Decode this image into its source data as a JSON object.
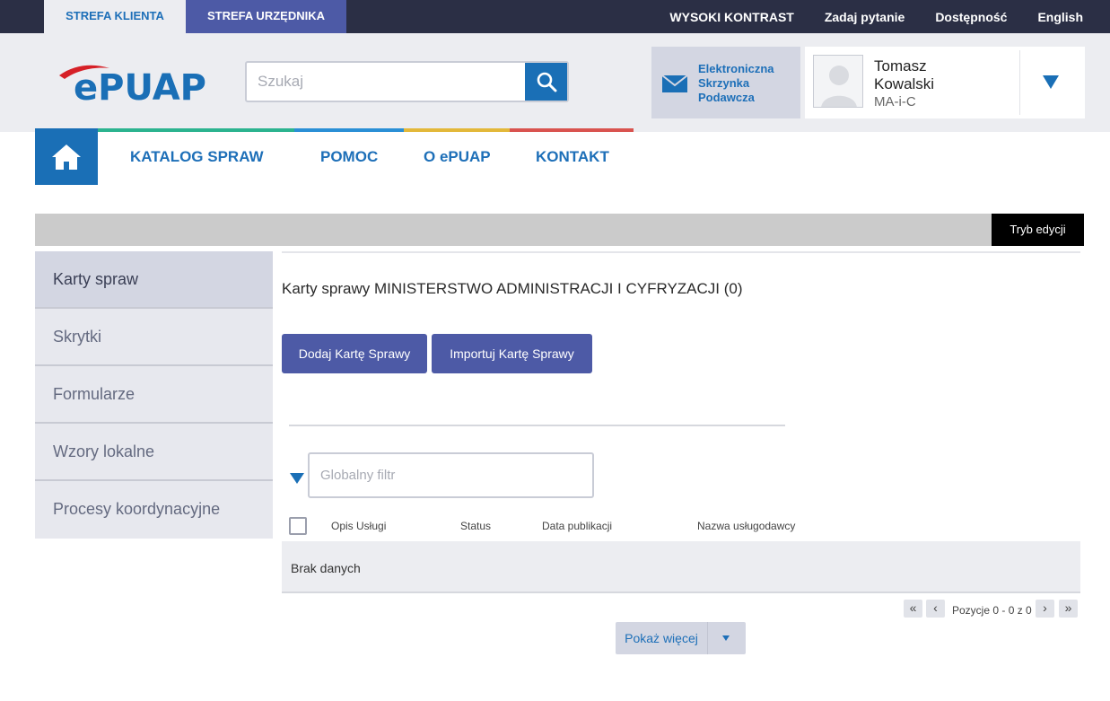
{
  "topbar": {
    "tab_client": "STREFA KLIENTA",
    "tab_official": "STREFA URZĘDNIKA",
    "links": [
      "WYSOKI KONTRAST",
      "Zadaj pytanie",
      "Dostępność",
      "English"
    ]
  },
  "header": {
    "logo_text": "ePUAP",
    "search_placeholder": "Szukaj",
    "eskrzynka_label": "Elektroniczna Skrzynka Podawcza",
    "user": {
      "first_name": "Tomasz",
      "last_name": "Kowalski",
      "org": "MA-i-C"
    }
  },
  "nav": {
    "items": [
      "KATALOG SPRAW",
      "POMOC",
      "O ePUAP",
      "KONTAKT"
    ]
  },
  "editbar": {
    "tryb_label": "Tryb edycji"
  },
  "sidebar": {
    "items": [
      "Karty spraw",
      "Skrytki",
      "Formularze",
      "Wzory lokalne",
      "Procesy koordynacyjne"
    ]
  },
  "main": {
    "title": "Karty sprawy MINISTERSTWO ADMINISTRACJI I CYFRYZACJI (0)",
    "add_button": "Dodaj Kartę Sprawy",
    "import_button": "Importuj Kartę Sprawy",
    "filter_placeholder": "Globalny filtr",
    "columns": [
      "Opis Usługi",
      "Status",
      "Data publikacji",
      "Nazwa usługodawcy"
    ],
    "no_data": "Brak danych",
    "pager": {
      "first": "«",
      "prev": "‹",
      "next": "›",
      "last": "»",
      "positions": "Pozycje 0 - 0 z 0"
    },
    "show_more": "Pokaż więcej"
  },
  "colors": {
    "primary_blue": "#1a6fb6",
    "button_indigo": "#4d5aa6",
    "nav_bar_teal": "#2bb38f",
    "nav_bar_blue": "#2a8fd6",
    "nav_bar_yellow": "#e3b83a",
    "nav_bar_red": "#d9534f"
  }
}
